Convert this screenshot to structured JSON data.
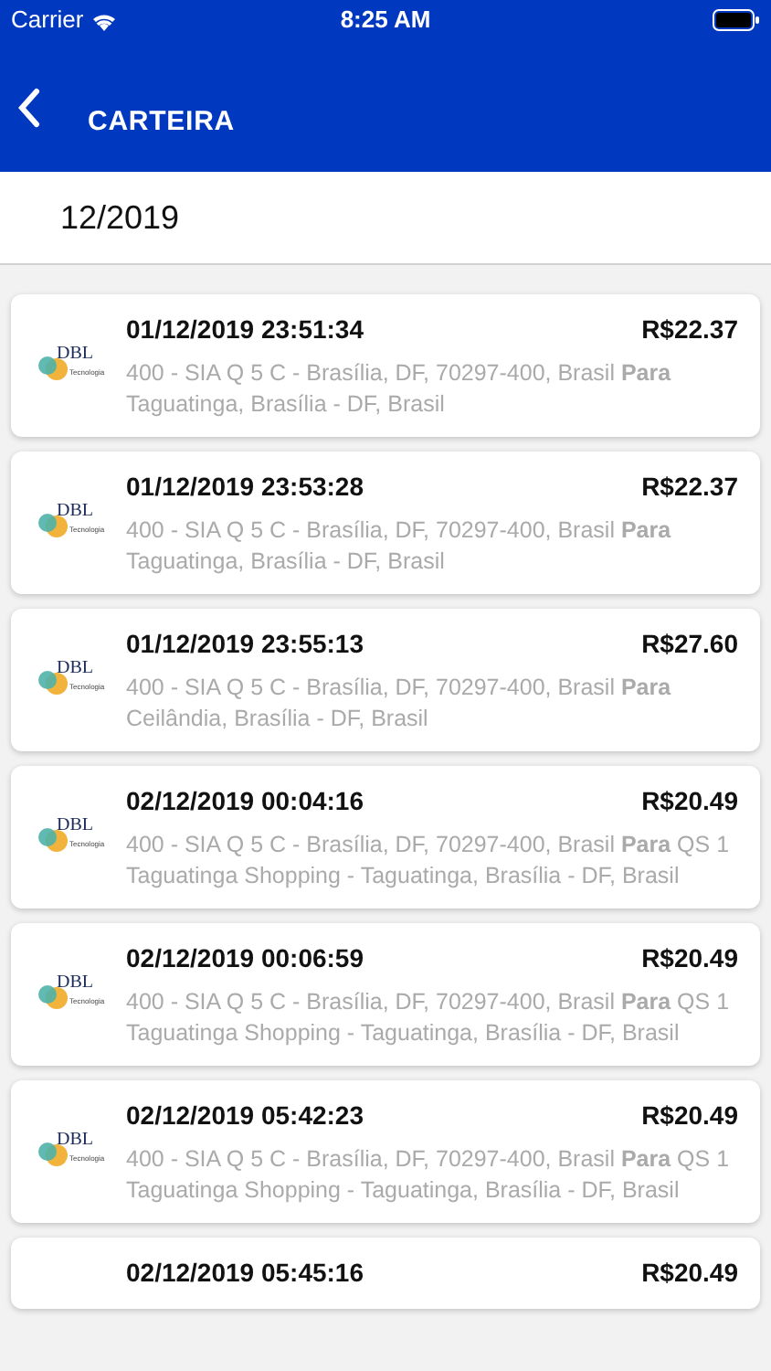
{
  "status_bar": {
    "carrier": "Carrier",
    "time": "8:25 AM"
  },
  "header": {
    "title": "CARTEIRA"
  },
  "month": "12/2019",
  "trips": [
    {
      "datetime": "01/12/2019 23:51:34",
      "price": "R$22.37",
      "route": "400 - SIA Q 5 C - Brasília, DF, 70297-400, Brasil **Para** Taguatinga, Brasília - DF, Brasil",
      "logo": {
        "name": "DBL",
        "tagline": "Tecnologia"
      }
    },
    {
      "datetime": "01/12/2019 23:53:28",
      "price": "R$22.37",
      "route": "400 - SIA Q 5 C - Brasília, DF, 70297-400, Brasil **Para** Taguatinga, Brasília - DF, Brasil",
      "logo": {
        "name": "DBL",
        "tagline": "Tecnologia"
      }
    },
    {
      "datetime": "01/12/2019 23:55:13",
      "price": "R$27.60",
      "route": "400 - SIA Q 5 C - Brasília, DF, 70297-400, Brasil **Para** Ceilândia, Brasília - DF, Brasil",
      "logo": {
        "name": "DBL",
        "tagline": "Tecnologia"
      }
    },
    {
      "datetime": "02/12/2019 00:04:16",
      "price": "R$20.49",
      "route": "400 - SIA Q 5 C - Brasília, DF, 70297-400, Brasil **Para** QS 1 Taguatinga Shopping - Taguatinga, Brasília - DF, Brasil",
      "logo": {
        "name": "DBL",
        "tagline": "Tecnologia"
      }
    },
    {
      "datetime": "02/12/2019 00:06:59",
      "price": "R$20.49",
      "route": "400 - SIA Q 5 C - Brasília, DF, 70297-400, Brasil **Para** QS 1 Taguatinga Shopping - Taguatinga, Brasília - DF, Brasil",
      "logo": {
        "name": "DBL",
        "tagline": "Tecnologia"
      }
    },
    {
      "datetime": "02/12/2019 05:42:23",
      "price": "R$20.49",
      "route": "400 - SIA Q 5 C - Brasília, DF, 70297-400, Brasil **Para** QS 1 Taguatinga Shopping - Taguatinga, Brasília - DF, Brasil",
      "logo": {
        "name": "DBL",
        "tagline": "Tecnologia"
      }
    },
    {
      "datetime": "02/12/2019 05:45:16",
      "price": "R$20.49"
    }
  ]
}
